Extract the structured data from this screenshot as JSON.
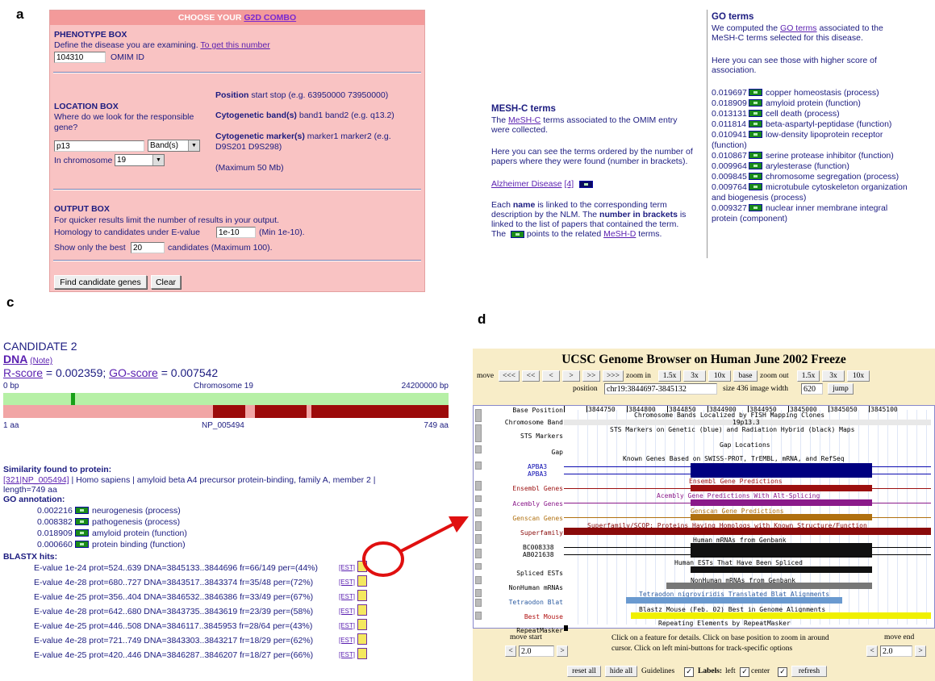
{
  "labels": {
    "a": "a",
    "b": "b",
    "c": "c",
    "d": "d"
  },
  "panel_a": {
    "title_prefix": "CHOOSE YOUR ",
    "title_link": "G2D COMBO",
    "phenotype": {
      "heading": "PHENOTYPE BOX",
      "desc": "Define the disease you are examining.",
      "link": "To get this number",
      "value": "104310",
      "suffix": "OMIM ID"
    },
    "location": {
      "heading": "LOCATION BOX",
      "desc1": "Where do we look for the responsible",
      "desc2": "gene?",
      "value": "p13",
      "select": "Band(s)",
      "chrom_label": "In chromosome",
      "chrom_value": "19",
      "pos_bold": "Position",
      "pos_text": " start stop (e.g. 63950000 73950000)",
      "band_bold": "Cytogenetic band(s)",
      "band_text": " band1 band2 (e.g. q13.2)",
      "marker_bold": "Cytogenetic marker(s)",
      "marker_text": " marker1 marker2 (e.g.",
      "marker_text2": "D9S201 D9S298)",
      "max": "(Maximum 50 Mb)"
    },
    "output": {
      "heading": "OUTPUT BOX",
      "desc": "For quicker results limit the number of results in your output.",
      "homology_label": "Homology to candidates under E-value",
      "homology_value": "1e-10",
      "homology_suffix": "(Min 1e-10).",
      "best_label": "Show only the best",
      "best_value": "20",
      "best_suffix": "candidates (Maximum 100)."
    },
    "buttons": {
      "find": "Find candidate genes",
      "clear": "Clear"
    }
  },
  "panel_b": {
    "mesh": {
      "heading": "MESH-C terms",
      "p1_pre": "The ",
      "p1_link": "MeSH-C",
      "p1_post": " terms associated to the OMIM entry",
      "p1_l2": "were collected.",
      "p2_l1": "Here you can see the terms ordered by the number of",
      "p2_l2": "papers where they were found (number in brackets).",
      "term_link": "Alzheimer Disease",
      "term_count": "[4]",
      "p3_l1_pre": "Each ",
      "p3_l1_bold": "name",
      "p3_l1_post": " is linked to the corresponding term",
      "p3_l2_pre": "description by the NLM. The ",
      "p3_l2_bold": "number in brackets",
      "p3_l2_post": " is",
      "p3_l3": "linked to the list of papers that contained the term.",
      "p3_l4_pre": "The ",
      "p3_l4_mid": " points to the related ",
      "p3_l4_link": "MeSH-D",
      "p3_l4_post": " terms."
    },
    "go": {
      "heading": "GO terms",
      "p1_pre": "We computed the ",
      "p1_link": "GO terms",
      "p1_post": " associated to the",
      "p1_l2": "MeSH-C terms selected for this disease.",
      "p2_l1": "Here you can see those with higher score of",
      "p2_l2": "association.",
      "terms": [
        {
          "score": "0.019697",
          "text": "copper homeostasis (process)",
          "cont": ""
        },
        {
          "score": "0.018909",
          "text": "amyloid protein (function)",
          "cont": ""
        },
        {
          "score": "0.013131",
          "text": "cell death (process)",
          "cont": ""
        },
        {
          "score": "0.011814",
          "text": "beta-aspartyl-peptidase (function)",
          "cont": ""
        },
        {
          "score": "0.010941",
          "text": "low-density lipoprotein receptor",
          "cont": "(function)"
        },
        {
          "score": "0.010867",
          "text": "serine protease inhibitor (function)",
          "cont": ""
        },
        {
          "score": "0.009964",
          "text": "arylesterase (function)",
          "cont": ""
        },
        {
          "score": "0.009845",
          "text": "chromosome segregation (process)",
          "cont": ""
        },
        {
          "score": "0.009764",
          "text": "microtubule cytoskeleton organization",
          "cont": "and biogenesis (process)"
        },
        {
          "score": "0.009327",
          "text": "nuclear inner membrane integral",
          "cont": "protein (component)"
        }
      ]
    }
  },
  "panel_c": {
    "title": "CANDIDATE 2",
    "dna": "DNA",
    "note": "(Note)",
    "rscore_label": "R-score",
    "rscore_value": " = 0.002359; ",
    "goscore_label": "GO-score",
    "goscore_value": " = 0.007542",
    "bp_start": "0 bp",
    "chrom": "Chromosome 19",
    "bp_end": "24200000 bp",
    "aa_start": "1 aa",
    "protein": "NP_005494",
    "aa_end": "749 aa",
    "similarity_heading": "Similarity found to protein:",
    "similarity_link": "[321|NP_005494]",
    "similarity_text": " | Homo sapiens | amyloid beta A4 precursor protein-binding, family A, member 2 |",
    "similarity_l2": "length=749 aa",
    "go_heading": "GO annotation:",
    "go_terms": [
      {
        "score": "0.002216",
        "text": "neurogenesis (process)"
      },
      {
        "score": "0.008382",
        "text": "pathogenesis (process)"
      },
      {
        "score": "0.018909",
        "text": "amyloid protein (function)"
      },
      {
        "score": "0.000660",
        "text": "protein binding (function)"
      }
    ],
    "blast_heading": "BLASTX hits:",
    "est_label": "[EST]",
    "hits": [
      "E-value 1e-24 prot=524..639 DNA=3845133..3844696 fr=66/149 per=(44%)",
      "E-value 4e-28 prot=680..727 DNA=3843517..3843374 fr=35/48 per=(72%)",
      "E-value 4e-25 prot=356..404 DNA=3846532..3846386 fr=33/49 per=(67%)",
      "E-value 4e-28 prot=642..680 DNA=3843735..3843619 fr=23/39 per=(58%)",
      "E-value 4e-25 prot=446..508 DNA=3846117..3845953 fr=28/64 per=(43%)",
      "E-value 4e-28 prot=721..749 DNA=3843303..3843217 fr=18/29 per=(62%)",
      "E-value 4e-25 prot=420..446 DNA=3846287..3846207 fr=18/27 per=(66%)"
    ]
  },
  "panel_d": {
    "title": "UCSC Genome Browser on Human June 2002 Freeze",
    "move_label": "move",
    "nav_buttons": [
      "<<<",
      "<<",
      "<",
      ">",
      ">>",
      ">>>"
    ],
    "zoomin_label": "zoom in",
    "zoomin_buttons": [
      "1.5x",
      "3x",
      "10x",
      "base"
    ],
    "zoomout_label": "zoom out",
    "zoomout_buttons": [
      "1.5x",
      "3x",
      "10x"
    ],
    "position_label": "position",
    "position_value": "chr19:3844697-3845132",
    "size_label": "size 436 image width",
    "width_value": "620",
    "jump": "jump",
    "base_position_label": "Base Position",
    "ticks": [
      "3844750",
      "3844800",
      "3844850",
      "3844900",
      "3844950",
      "3845000",
      "3845050",
      "3845100"
    ],
    "chrom_band_label": "Chromosome Band",
    "chrom_band_title": "Chromosome Bands Localized by FISH Mapping Clones",
    "band": "19p13.3",
    "sts_label": "STS Markers",
    "sts_title": "STS Markers on Genetic (blue) and Radiation Hybrid (black) Maps",
    "gap_label": "Gap",
    "gap_title": "Gap Locations",
    "known_title": "Known Genes Based on SWISS-PROT, TrEMBL, mRNA, and RefSeq",
    "apba3": [
      "APBA3",
      "APBA3"
    ],
    "ensembl_label": "Ensembl Genes",
    "ensembl_title": "Ensembl Gene Predictions",
    "acembly_label": "Acembly Genes",
    "acembly_title": "Acembly Gene Predictions With Alt-Splicing",
    "genscan_label": "Genscan Genes",
    "genscan_title": "Genscan Gene Predictions",
    "superfam_label": "Superfamily",
    "superfam_title": "Superfamily/SCOP: Proteins Having Homologs with Known Structure/Function",
    "mrna_title": "Human mRNAs from Genbank",
    "mrnas": [
      "BC008338",
      "AB021638"
    ],
    "est_title": "Human ESTs That Have Been Spliced",
    "spliced_label": "Spliced ESTs",
    "nonhuman_label": "NonHuman mRNAs",
    "nonhuman_title": "NonHuman mRNAs from Genbank",
    "tetraodon_label": "Tetraodon Blat",
    "tetraodon_title": "Tetraodon nigroviridis Translated Blat Alignments",
    "bestmouse_label": "Best Mouse",
    "bestmouse_title": "Blastz Mouse (Feb. 02) Best in Genome Alignments",
    "repeat_label": "RepeatMasker",
    "repeat_title": "Repeating Elements by RepeatMasker",
    "move_start": "move start",
    "move_end": "move end",
    "move_start_value": "2.0",
    "move_end_value": "2.0",
    "help1": "Click on a feature for details. Click on base position to zoom in around",
    "help2": "cursor. Click on left mini-buttons for track-specific options",
    "reset": "reset all",
    "hide": "hide all",
    "guidelines": "Guidelines",
    "labels_bold": "Labels:",
    "left": "left",
    "center": "center",
    "refresh": "refresh"
  }
}
